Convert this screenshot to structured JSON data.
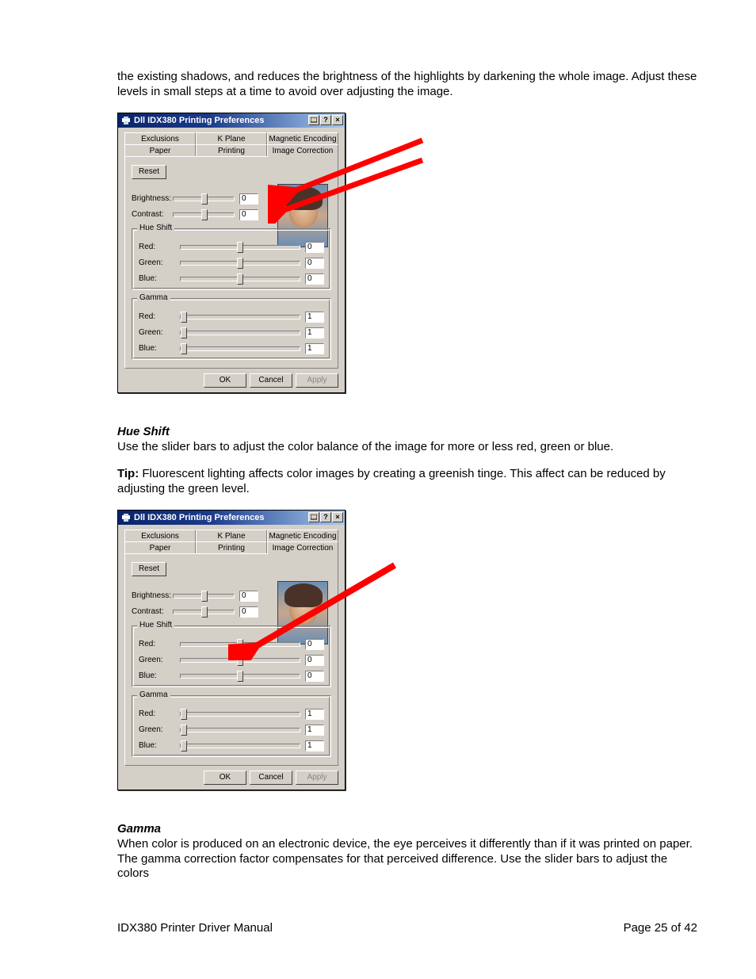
{
  "intro_text": "the existing shadows, and reduces the brightness of the highlights by darkening the whole image. Adjust these levels in small steps at a time to avoid over adjusting the image.",
  "section1": {
    "heading": "Hue Shift",
    "text": "Use the slider bars to adjust the color balance of the image for more or less red, green or blue.",
    "tip_label": "Tip:",
    "tip_text": " Fluorescent lighting affects color images by creating a greenish tinge. This affect can be reduced by adjusting the green level."
  },
  "section2": {
    "heading": "Gamma",
    "text": "When color is produced on an electronic device, the eye perceives it differently than if it was printed on paper. The gamma correction factor compensates for that perceived difference. Use the slider bars to adjust the colors"
  },
  "dialog": {
    "title": "Dll IDX380 Printing Preferences",
    "cap_help": "?",
    "cap_close": "×",
    "tabs_back": [
      "Exclusions",
      "K Plane",
      "Magnetic Encoding"
    ],
    "tabs_front": [
      "Paper",
      "Printing",
      "Image Correction"
    ],
    "reset": "Reset",
    "brightness_label": "Brightness:",
    "brightness_value": "0",
    "contrast_label": "Contrast:",
    "contrast_value": "0",
    "hue_group": "Hue Shift",
    "gamma_group": "Gamma",
    "red_label": "Red:",
    "green_label": "Green:",
    "blue_label": "Blue:",
    "hue_red": "0",
    "hue_green": "0",
    "hue_blue": "0",
    "gamma_red": "1",
    "gamma_green": "1",
    "gamma_blue": "1",
    "ok": "OK",
    "cancel": "Cancel",
    "apply": "Apply"
  },
  "footer": {
    "left": "IDX380 Printer Driver Manual",
    "right": "Page 25 of 42"
  }
}
